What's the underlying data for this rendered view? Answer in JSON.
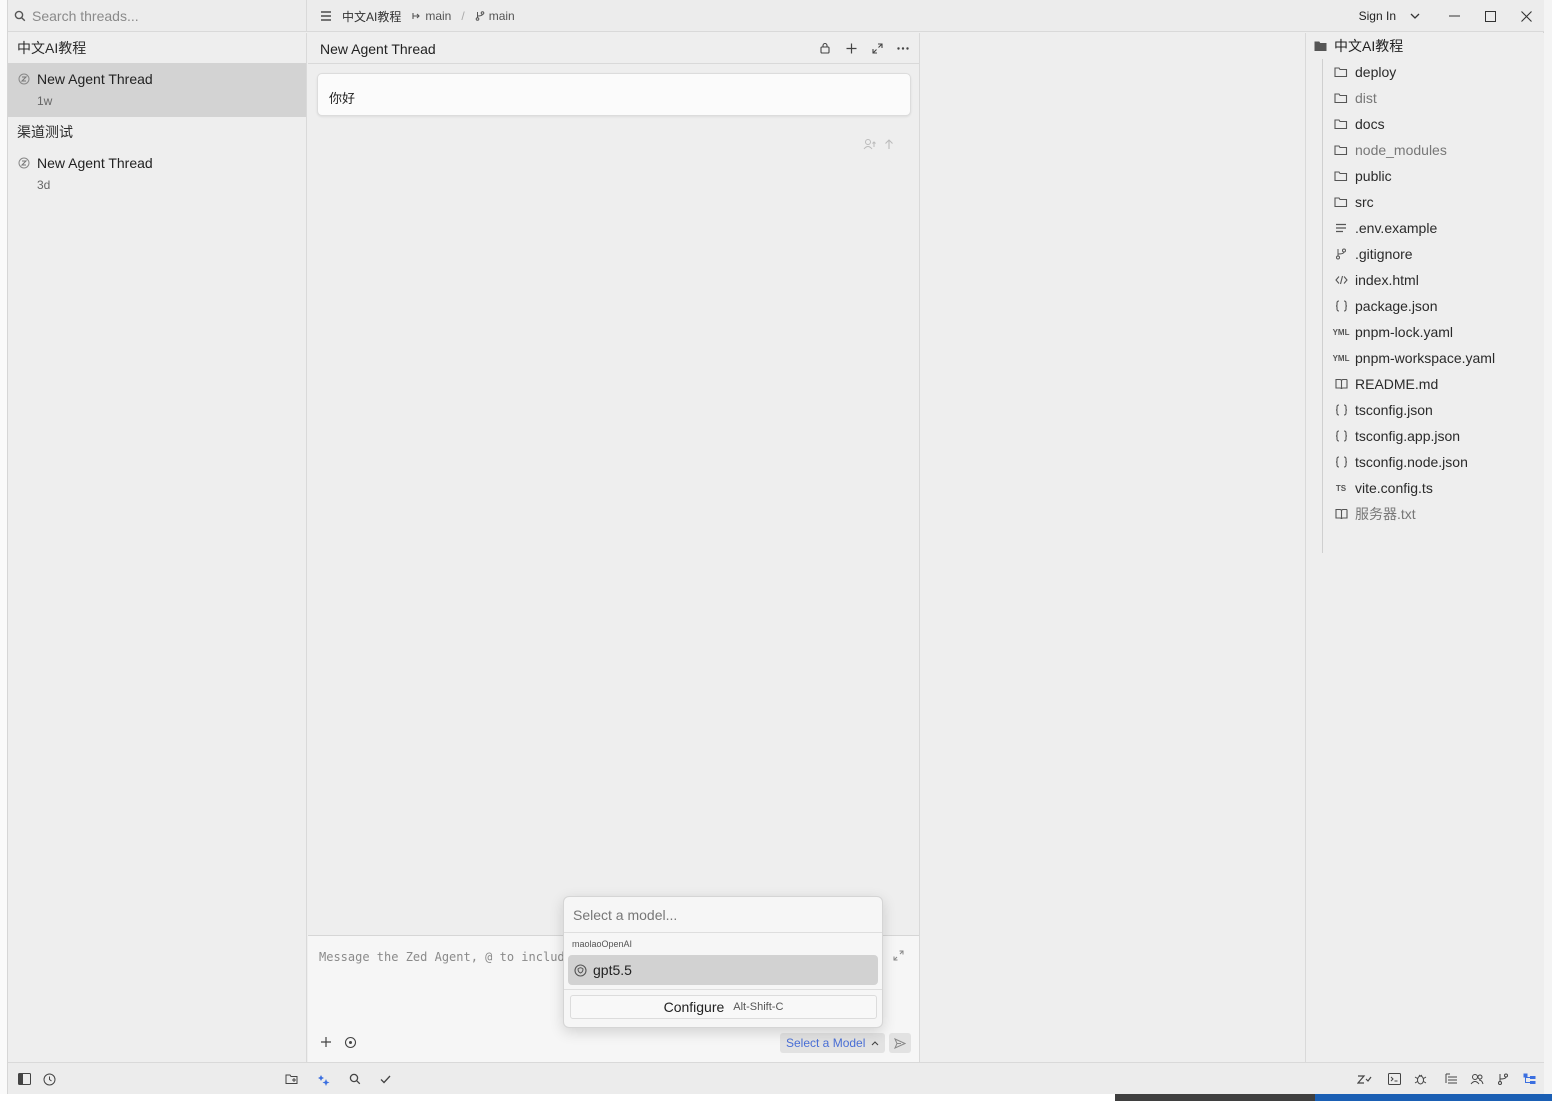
{
  "titlebar": {
    "search_placeholder": "Search threads...",
    "project_name": "中文AI教程",
    "worktree": "main",
    "separator": "/",
    "branch": "main",
    "sign_in": "Sign In"
  },
  "threads": {
    "groups": [
      {
        "name": "中文AI教程",
        "items": [
          {
            "title": "New Agent Thread",
            "time": "1w",
            "selected": true
          }
        ]
      },
      {
        "name": "渠道测试",
        "items": [
          {
            "title": "New Agent Thread",
            "time": "3d",
            "selected": false
          }
        ]
      }
    ]
  },
  "agent": {
    "title": "New Agent Thread",
    "user_message": "你好",
    "composer_placeholder": "Message the Zed Agent, @ to include context",
    "model_select_label": "Select a Model"
  },
  "model_picker": {
    "search_placeholder": "Select a model...",
    "provider": "maolaoOpenAI",
    "model": "gpt5.5",
    "configure_label": "Configure",
    "configure_shortcut": "Alt-Shift-C"
  },
  "project": {
    "root": "中文AI教程",
    "items": [
      {
        "name": "deploy",
        "icon": "folder-icon",
        "ignored": false
      },
      {
        "name": "dist",
        "icon": "folder-icon",
        "ignored": true
      },
      {
        "name": "docs",
        "icon": "folder-icon",
        "ignored": false
      },
      {
        "name": "node_modules",
        "icon": "folder-icon",
        "ignored": true
      },
      {
        "name": "public",
        "icon": "folder-icon",
        "ignored": false
      },
      {
        "name": "src",
        "icon": "folder-icon",
        "ignored": false
      },
      {
        "name": ".env.example",
        "icon": "text-lines-icon",
        "ignored": false
      },
      {
        "name": ".gitignore",
        "icon": "git-icon",
        "ignored": false
      },
      {
        "name": "index.html",
        "icon": "code-icon",
        "ignored": false
      },
      {
        "name": "package.json",
        "icon": "braces-icon",
        "ignored": false
      },
      {
        "name": "pnpm-lock.yaml",
        "icon": "yaml-icon",
        "ignored": false
      },
      {
        "name": "pnpm-workspace.yaml",
        "icon": "yaml-icon",
        "ignored": false
      },
      {
        "name": "README.md",
        "icon": "book-icon",
        "ignored": false
      },
      {
        "name": "tsconfig.json",
        "icon": "braces-icon",
        "ignored": false
      },
      {
        "name": "tsconfig.app.json",
        "icon": "braces-icon",
        "ignored": false
      },
      {
        "name": "tsconfig.node.json",
        "icon": "braces-icon",
        "ignored": false
      },
      {
        "name": "vite.config.ts",
        "icon": "typescript-icon",
        "ignored": false
      },
      {
        "name": "服务器.txt",
        "icon": "book-icon",
        "ignored": true
      }
    ]
  },
  "icon_glyphs": {
    "yaml": "YML",
    "typescript": "TS"
  },
  "colors": {
    "accent": "#3b6fe0",
    "selected_row": "#d3d3d3",
    "panel_bg": "#eeeeee"
  }
}
